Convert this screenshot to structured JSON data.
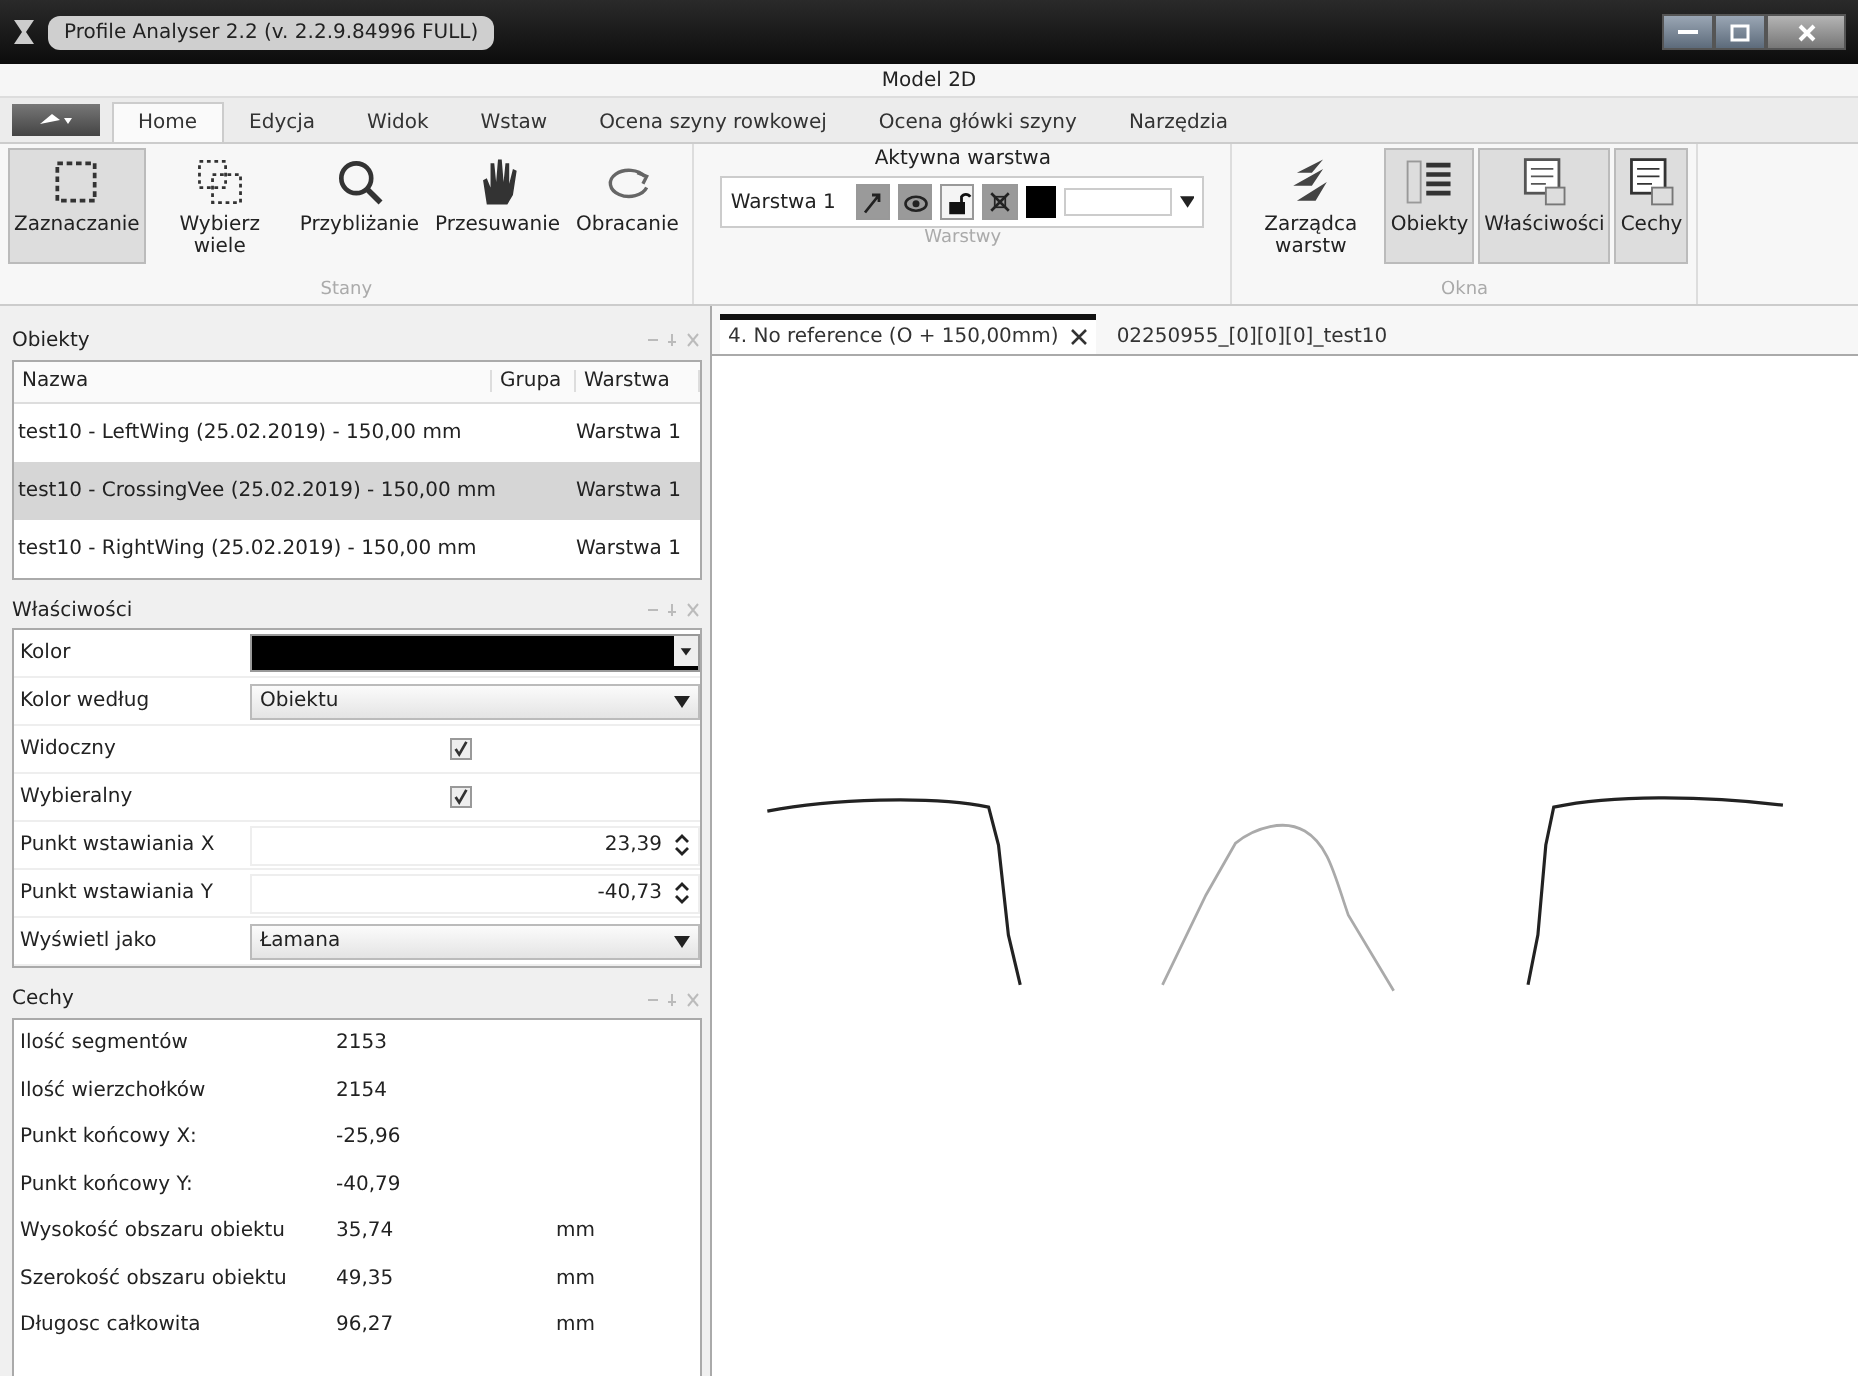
{
  "window": {
    "title": "Profile Analyser 2.2 (v. 2.2.9.84996 FULL)",
    "context_title": "Model 2D"
  },
  "ribbon_tabs": [
    {
      "label": "Home",
      "selected": true
    },
    {
      "label": "Edycja",
      "selected": false
    },
    {
      "label": "Widok",
      "selected": false
    },
    {
      "label": "Wstaw",
      "selected": false
    },
    {
      "label": "Ocena szyny rowkowej",
      "selected": false
    },
    {
      "label": "Ocena główki szyny",
      "selected": false
    },
    {
      "label": "Narzędzia",
      "selected": false
    }
  ],
  "ribbon_groups": [
    {
      "name": "Stany",
      "kind": "tools",
      "items": [
        {
          "label": "Zaznaczanie",
          "selected": true
        },
        {
          "label": "Wybierz wiele",
          "selected": false
        },
        {
          "label": "Przybliżanie",
          "selected": false
        },
        {
          "label": "Przesuwanie",
          "selected": false
        },
        {
          "label": "Obracanie",
          "selected": false
        }
      ]
    },
    {
      "name": "Warstwy",
      "kind": "layer",
      "caption": "Aktywna warstwa",
      "layer": "Warstwa 1",
      "toggles": [
        {
          "on": true
        },
        {
          "on": true
        },
        {
          "on": false
        },
        {
          "on": true
        }
      ],
      "color": "#000000"
    },
    {
      "name": "Okna",
      "kind": "tools",
      "items": [
        {
          "label": "Zarządca warstw",
          "selected": false
        },
        {
          "label": "Obiekty",
          "selected": true
        },
        {
          "label": "Właściwości",
          "selected": true
        },
        {
          "label": "Cechy",
          "selected": true
        }
      ]
    }
  ],
  "objects_panel": {
    "title": "Obiekty",
    "columns": [
      "Nazwa",
      "Grupa",
      "Warstwa"
    ],
    "rows": [
      {
        "name": "test10 - LeftWing (25.02.2019) - 150,00 mm",
        "layer": "Warstwa 1",
        "selected": false
      },
      {
        "name": "test10 - CrossingVee (25.02.2019) - 150,00 mm",
        "layer": "Warstwa 1",
        "selected": true
      },
      {
        "name": "test10 - RightWing (25.02.2019) - 150,00 mm",
        "layer": "Warstwa 1",
        "selected": false
      }
    ]
  },
  "properties_panel": {
    "title": "Właściwości",
    "rows": [
      {
        "label": "Kolor",
        "kind": "color",
        "color": "#000000"
      },
      {
        "label": "Kolor według",
        "kind": "dropdown",
        "value": "Obiektu"
      },
      {
        "label": "Widoczny",
        "kind": "checkbox",
        "checked": true
      },
      {
        "label": "Wybieralny",
        "kind": "checkbox",
        "checked": true
      },
      {
        "label": "Punkt wstawiania X",
        "kind": "number",
        "value": "23,39"
      },
      {
        "label": "Punkt wstawiania Y",
        "kind": "number",
        "value": "-40,73"
      },
      {
        "label": "Wyświetl jako",
        "kind": "dropdown",
        "value": "Łamana"
      }
    ]
  },
  "features_panel": {
    "title": "Cechy",
    "rows": [
      {
        "label": "Ilość segmentów",
        "value": "2153"
      },
      {
        "label": "Ilość wierzchołków",
        "value": "2154"
      },
      {
        "label": "Punkt końcowy X:",
        "value": "-25,96"
      },
      {
        "label": "Punkt końcowy Y:",
        "value": "-40,79"
      },
      {
        "label": "Wysokość obszaru obiektu",
        "value": "35,74",
        "unit": "mm"
      },
      {
        "label": "Szerokość obszaru obiektu",
        "value": "49,35",
        "unit": "mm"
      },
      {
        "label": "Długosc całkowita",
        "value": "96,27",
        "unit": "mm"
      }
    ]
  },
  "document_tabs": [
    {
      "label": "4. No reference (O + 150,00mm)",
      "selected": true
    },
    {
      "label": "02250955_[0][0][0]_test10",
      "selected": false
    }
  ]
}
